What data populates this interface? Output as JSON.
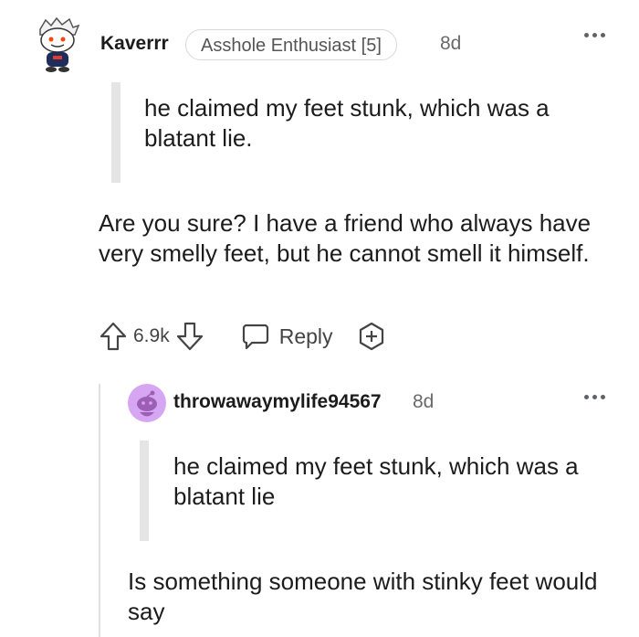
{
  "comment1": {
    "username": "Kaverrr",
    "flair": "Asshole Enthusiast [5]",
    "timestamp": "8d",
    "quote": "he claimed my feet stunk, which was a blatant lie.",
    "body": "Are you sure? I have a friend who always have very smelly feet, but he cannot smell it himself.",
    "score": "6.9k",
    "reply_label": "Reply"
  },
  "comment2": {
    "username": "throwawaymylife94567",
    "timestamp": "8d",
    "quote": "he claimed my feet stunk, which was a blatant lie",
    "body": "Is something someone with stinky feet would say"
  },
  "colors": {
    "text": "#1c1c1c",
    "meta": "#6a6a6a",
    "quote_bar": "#e5e5e5",
    "avatar2_bg": "#d7a6f2"
  },
  "icons": [
    "more-options-icon",
    "upvote-icon",
    "downvote-icon",
    "reply-icon",
    "award-icon"
  ]
}
